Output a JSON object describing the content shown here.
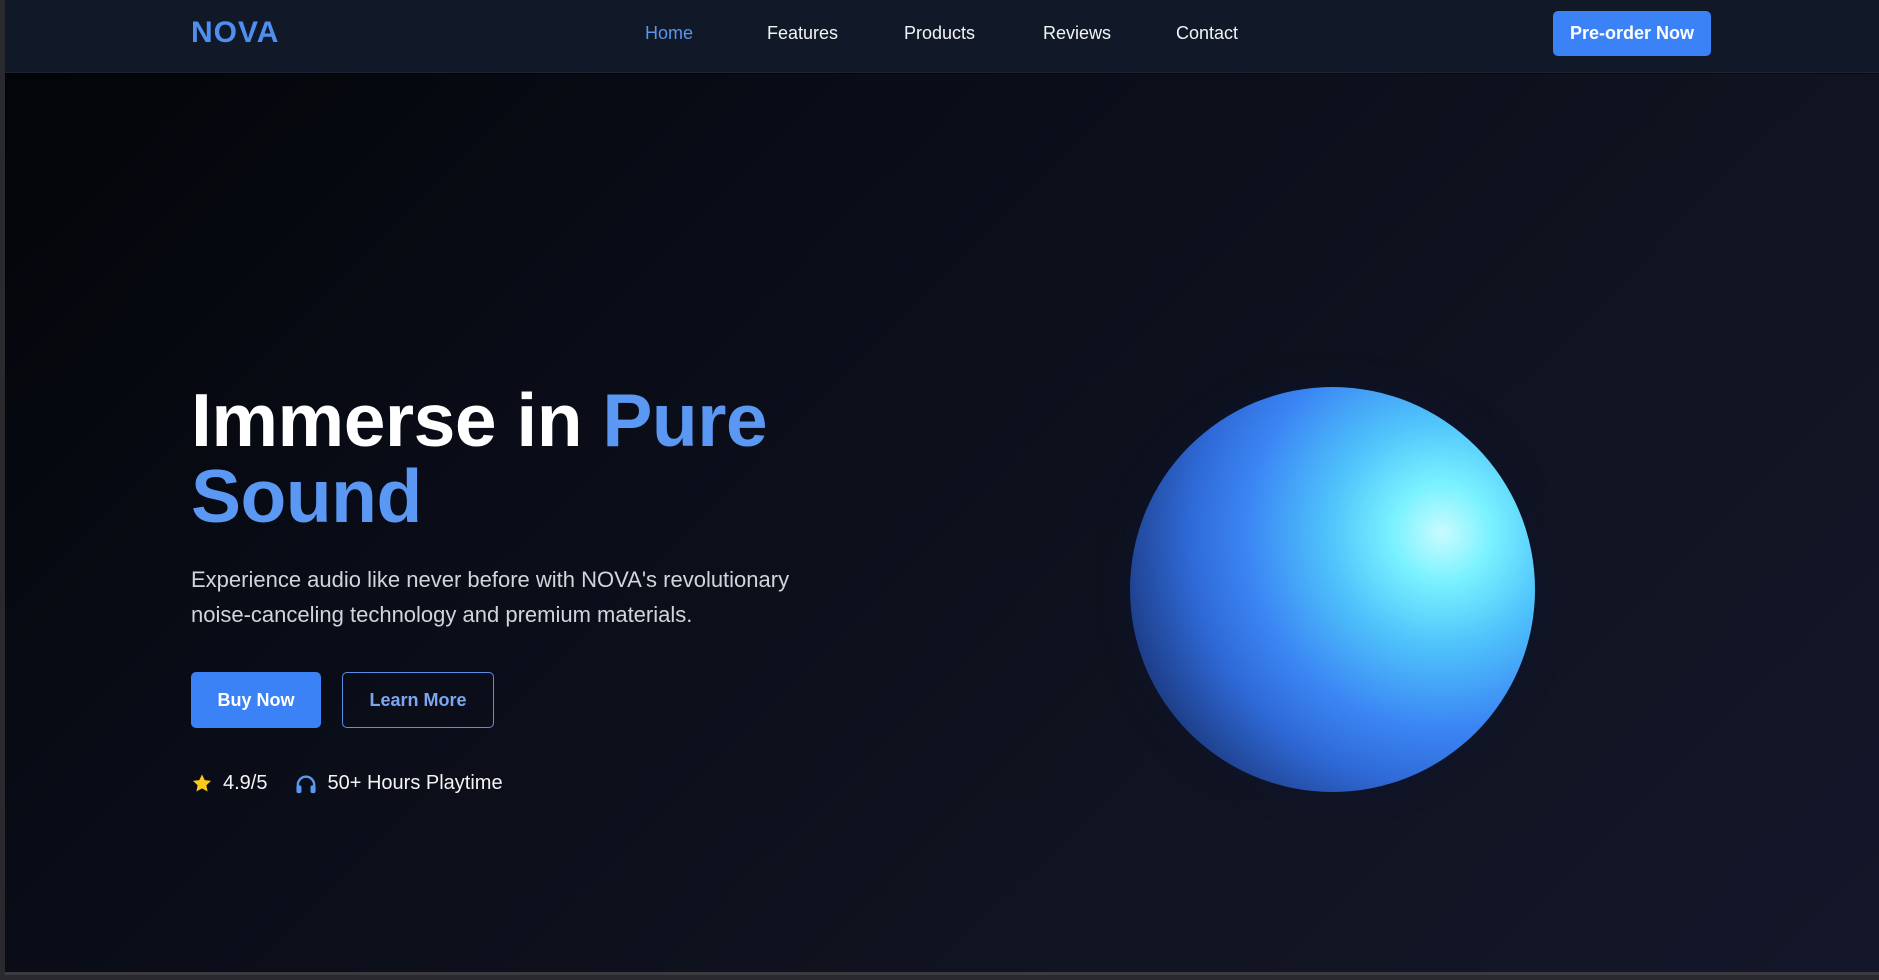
{
  "nav": {
    "logo": "NOVA",
    "links": [
      {
        "label": "Home",
        "active": true
      },
      {
        "label": "Features",
        "active": false
      },
      {
        "label": "Products",
        "active": false
      },
      {
        "label": "Reviews",
        "active": false
      },
      {
        "label": "Contact",
        "active": false
      }
    ],
    "cta": "Pre-order Now"
  },
  "hero": {
    "headline_part1": "Immerse in ",
    "headline_accent1": "Pure",
    "headline_accent2": "Sound",
    "subtext": "Experience audio like never before with NOVA's revolutionary noise-canceling technology and premium materials.",
    "primary_button": "Buy Now",
    "secondary_button": "Learn More",
    "stats": [
      {
        "icon": "star-icon",
        "label": "4.9/5"
      },
      {
        "icon": "headphones-icon",
        "label": "50+ Hours Playtime"
      }
    ]
  },
  "colors": {
    "accent": "#3b82f6",
    "accent_text": "#5b98f3",
    "star": "#facc15",
    "nav_bg": "#111827",
    "page_bg": "#0a0d18"
  }
}
